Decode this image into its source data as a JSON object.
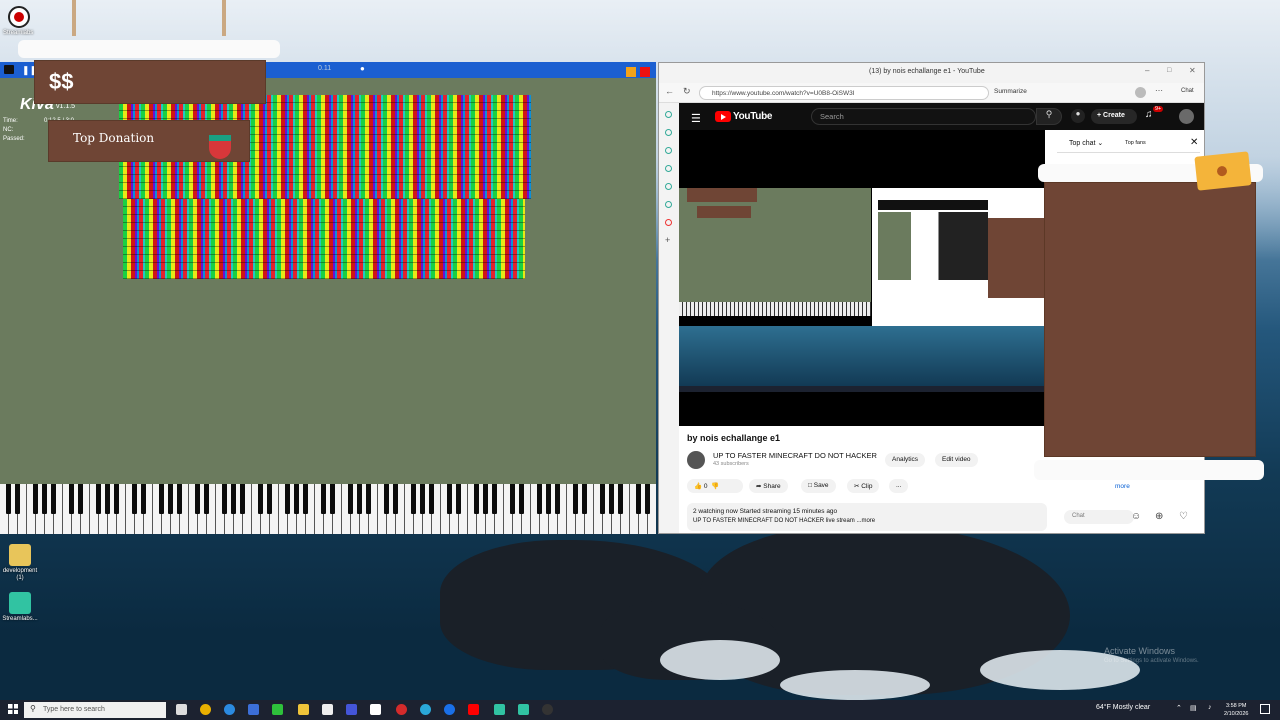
{
  "desktop": {
    "rec_label": "Streamlabs",
    "icon_folder": "development (1)",
    "icon_streamlabs": "Streamlabs...",
    "activate_title": "Activate Windows",
    "activate_sub": "Go to Settings to activate Windows."
  },
  "kiva": {
    "logo": "Kiva",
    "version": "v1.1.5",
    "stat_time": "Time:",
    "stat_time_val": "0:12.5 / 3:0",
    "stat_nc": "NC:",
    "stat_passed": "Passed:",
    "tempo": "0.11",
    "dollar": "$$",
    "top_donation": "Top Donation"
  },
  "browser": {
    "tab_title": "(13) by nois echallange e1 - YouTube",
    "url": "https://www.youtube.com/watch?v=U0B8-OiSW3I",
    "summarize": "Summarize",
    "chat": "Chat"
  },
  "youtube": {
    "brand": "YouTube",
    "search_placeholder": "Search",
    "create": "Create",
    "notif_count": "9+",
    "video_title": "by nois echallange e1",
    "channel": "UP TO FASTER MINECRAFT DO NOT HACKER",
    "subs": "43 subscribers",
    "analytics": "Analytics",
    "edit_video": "Edit video",
    "likes": "0",
    "share": "Share",
    "save": "Save",
    "clip": "Clip",
    "more_menu": "...",
    "desc_line1": "2 watching now  Started streaming 15 minutes ago",
    "desc_line2": "UP TO FASTER MINECRAFT DO NOT HACKER live stream  ...more",
    "chat_top": "Top chat",
    "chat_fans": "Top fans",
    "chat_more": "more",
    "chat_input": "Chat"
  },
  "taskbar": {
    "search_placeholder": "Type here to search",
    "weather": "64°F  Mostly clear",
    "time": "3:58 PM",
    "date": "2/10/2026"
  }
}
